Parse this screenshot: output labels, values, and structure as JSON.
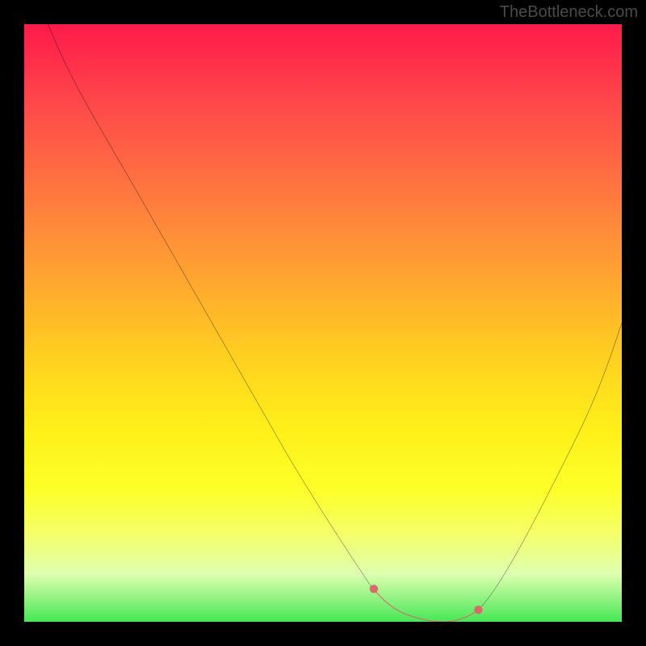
{
  "watermark": "TheBottleneck.com",
  "chart_data": {
    "type": "line",
    "title": "",
    "xlabel": "",
    "ylabel": "",
    "xlim": [
      0,
      100
    ],
    "ylim": [
      0,
      100
    ],
    "series": [
      {
        "name": "bottleneck-curve",
        "x": [
          4,
          10,
          20,
          30,
          40,
          50,
          56,
          60,
          64,
          68,
          72,
          76,
          84,
          92,
          100
        ],
        "y": [
          100,
          88,
          70,
          54,
          38,
          22,
          12,
          6,
          2,
          0,
          0,
          2,
          12,
          30,
          50
        ],
        "color": "#000000"
      },
      {
        "name": "optimal-range-highlight",
        "x": [
          60,
          64,
          68,
          72,
          76
        ],
        "y": [
          6,
          2,
          0,
          0,
          2
        ],
        "color": "#d86a6a"
      }
    ],
    "gradient": {
      "top_color": "#ff1a4a",
      "mid_color": "#ffd11f",
      "bottom_color": "#46e756"
    },
    "optimal_range": {
      "start_x": 60,
      "end_x": 76
    }
  }
}
